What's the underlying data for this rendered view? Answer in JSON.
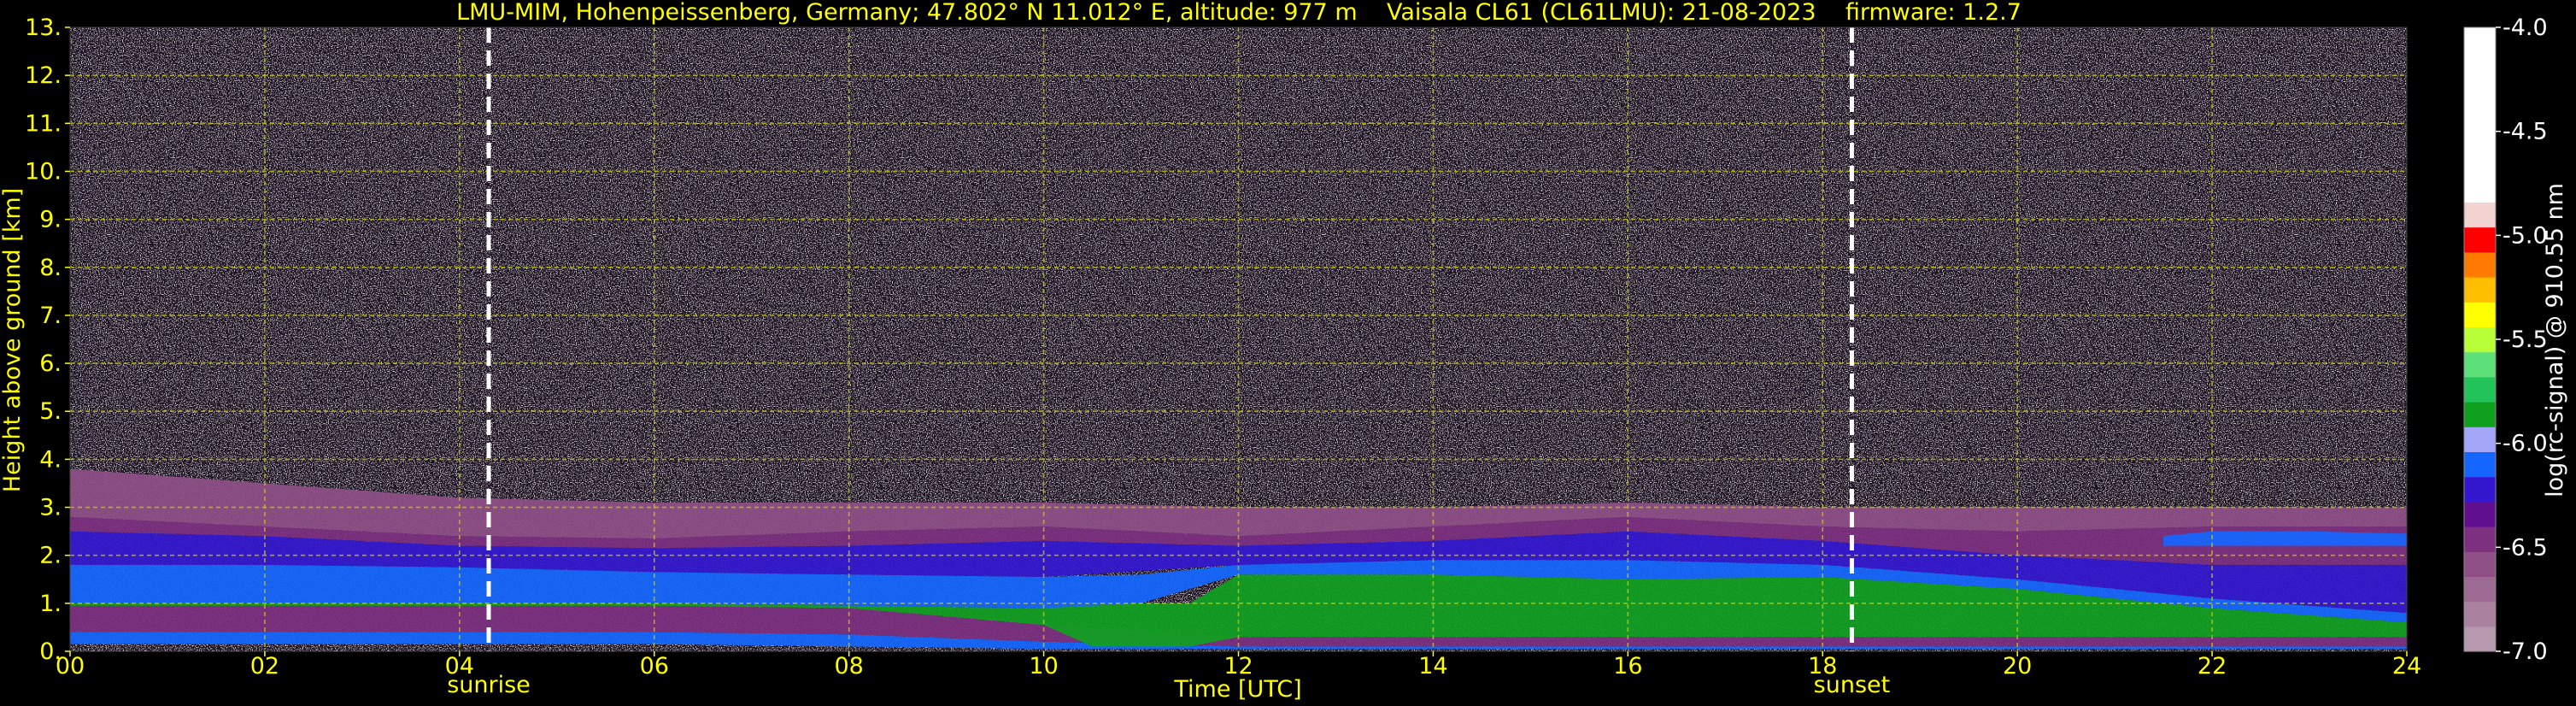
{
  "header": {
    "title": "LMU-MIM, Hohenpeissenberg, Germany; 47.802° N 11.012° E, altitude: 977 m    Vaisala CL61 (CL61LMU): 21-08-2023    firmware: 1.2.7"
  },
  "chart_data": {
    "type": "heatmap",
    "xlabel": "Time [UTC]",
    "ylabel": "Height above ground [km]",
    "xlim": [
      0,
      24
    ],
    "ylim": [
      0,
      13
    ],
    "x_ticks": [
      0,
      2,
      4,
      6,
      8,
      10,
      12,
      14,
      16,
      18,
      20,
      22,
      24
    ],
    "x_tick_labels": [
      "00",
      "02",
      "04",
      "06",
      "08",
      "10",
      "12",
      "14",
      "16",
      "18",
      "20",
      "22",
      "24"
    ],
    "y_ticks": [
      0,
      1,
      2,
      3,
      4,
      5,
      6,
      7,
      8,
      9,
      10,
      11,
      12,
      13
    ],
    "y_tick_labels": [
      "0.",
      "1.",
      "2.",
      "3.",
      "4.",
      "5.",
      "6.",
      "7.",
      "8.",
      "9.",
      "10.",
      "11.",
      "12.",
      "13."
    ],
    "grid": true,
    "markers": [
      {
        "label": "sunrise",
        "time": 4.3
      },
      {
        "label": "sunset",
        "time": 18.3
      }
    ],
    "colorbar": {
      "label": "log(rc-signal) @ 910.55 nm",
      "range": [
        -7.0,
        -4.0
      ],
      "ticks": [
        -4.0,
        -4.5,
        -5.0,
        -5.5,
        -6.0,
        -6.5,
        -7.0
      ],
      "tick_labels": [
        "-4.0",
        "-4.5",
        "-5.0",
        "-5.5",
        "-6.0",
        "-6.5",
        "-7.0"
      ],
      "steps": [
        {
          "from": -7.0,
          "to": -6.88,
          "color": "#b79aaf"
        },
        {
          "from": -6.88,
          "to": -6.76,
          "color": "#aa82a0"
        },
        {
          "from": -6.76,
          "to": -6.64,
          "color": "#9c6a93"
        },
        {
          "from": -6.64,
          "to": -6.52,
          "color": "#8e4f87"
        },
        {
          "from": -6.52,
          "to": -6.4,
          "color": "#7d2f80"
        },
        {
          "from": -6.4,
          "to": -6.28,
          "color": "#5f0f90"
        },
        {
          "from": -6.28,
          "to": -6.16,
          "color": "#3418d0"
        },
        {
          "from": -6.16,
          "to": -6.04,
          "color": "#1466ff"
        },
        {
          "from": -6.04,
          "to": -5.92,
          "color": "#a4a6f8"
        },
        {
          "from": -5.92,
          "to": -5.8,
          "color": "#10a020"
        },
        {
          "from": -5.8,
          "to": -5.68,
          "color": "#22c45a"
        },
        {
          "from": -5.68,
          "to": -5.56,
          "color": "#5ee07a"
        },
        {
          "from": -5.56,
          "to": -5.44,
          "color": "#b8ff38"
        },
        {
          "from": -5.44,
          "to": -5.32,
          "color": "#ffff00"
        },
        {
          "from": -5.32,
          "to": -5.2,
          "color": "#ffbe00"
        },
        {
          "from": -5.2,
          "to": -5.08,
          "color": "#ff7a00"
        },
        {
          "from": -5.08,
          "to": -4.96,
          "color": "#ff0000"
        },
        {
          "from": -4.96,
          "to": -4.84,
          "color": "#f3d2d2"
        },
        {
          "from": -4.84,
          "to": -4.0,
          "color": "#ffffff"
        }
      ]
    },
    "layers": [
      {
        "time": [
          0,
          2,
          4,
          6,
          8,
          10,
          12,
          14,
          16,
          18,
          20,
          22,
          24
        ],
        "bottom": [
          0.15,
          0.15,
          0.15,
          0.15,
          0.1,
          0.05,
          0.05,
          0.05,
          0.05,
          0.05,
          0.05,
          0.05,
          0.05
        ],
        "top": [
          0.4,
          0.4,
          0.4,
          0.4,
          0.35,
          0.2,
          0.1,
          0.1,
          0.1,
          0.1,
          0.1,
          0.1,
          0.1
        ],
        "value": -6.1
      },
      {
        "time": [
          0,
          2,
          4,
          6,
          8,
          10,
          12,
          14,
          16,
          18,
          20,
          22,
          24
        ],
        "bottom": [
          0.4,
          0.4,
          0.4,
          0.4,
          0.35,
          0.2,
          0.1,
          0.1,
          0.1,
          0.1,
          0.1,
          0.1,
          0.1
        ],
        "top": [
          0.95,
          0.95,
          0.95,
          0.95,
          0.9,
          0.55,
          0.3,
          0.3,
          0.3,
          0.3,
          0.3,
          0.3,
          0.3
        ],
        "value": -6.42
      },
      {
        "time": [
          0,
          2,
          4,
          6,
          8,
          10,
          10.5,
          11.5,
          12,
          14,
          16,
          18,
          20,
          22,
          24
        ],
        "bottom": [
          0.95,
          0.95,
          0.95,
          0.95,
          0.9,
          0.55,
          0.1,
          0.1,
          0.3,
          0.3,
          0.3,
          0.3,
          0.3,
          0.3,
          0.3
        ],
        "top": [
          1.0,
          1.0,
          1.0,
          1.0,
          0.95,
          0.9,
          1.0,
          1.0,
          1.6,
          1.6,
          1.5,
          1.55,
          1.3,
          0.9,
          0.6
        ],
        "value": -5.85
      },
      {
        "time": [
          0,
          2,
          4,
          6,
          8,
          10,
          11,
          12,
          14,
          16,
          18,
          20,
          22,
          24
        ],
        "bottom": [
          1.0,
          1.0,
          1.0,
          1.0,
          0.95,
          0.9,
          1.0,
          1.6,
          1.6,
          1.5,
          1.55,
          1.3,
          0.9,
          0.6
        ],
        "top": [
          1.8,
          1.8,
          1.75,
          1.65,
          1.6,
          1.55,
          1.6,
          1.8,
          1.9,
          1.9,
          1.8,
          1.5,
          1.1,
          0.8
        ],
        "value": -6.1
      },
      {
        "time": [
          0,
          2,
          4,
          6,
          8,
          10,
          12,
          14,
          16,
          18,
          20,
          22,
          24
        ],
        "bottom": [
          1.8,
          1.8,
          1.75,
          1.65,
          1.6,
          1.55,
          1.8,
          1.9,
          1.9,
          1.8,
          1.5,
          1.1,
          0.8
        ],
        "top": [
          2.5,
          2.4,
          2.2,
          2.15,
          2.2,
          2.3,
          2.2,
          2.3,
          2.5,
          2.3,
          2.0,
          1.8,
          1.8
        ],
        "value": -6.25
      },
      {
        "time": [
          0,
          2,
          4,
          6,
          8,
          10,
          12,
          14,
          16,
          18,
          20,
          22,
          24
        ],
        "bottom": [
          2.5,
          2.4,
          2.2,
          2.15,
          2.2,
          2.3,
          2.2,
          2.3,
          2.5,
          2.3,
          2.0,
          1.8,
          1.8
        ],
        "top": [
          2.8,
          2.6,
          2.4,
          2.35,
          2.5,
          2.6,
          2.4,
          2.6,
          2.8,
          2.6,
          2.5,
          2.6,
          2.6
        ],
        "value": -6.45
      },
      {
        "time": [
          21.5,
          22,
          23,
          24
        ],
        "bottom": [
          2.2,
          2.2,
          2.2,
          2.2
        ],
        "top": [
          2.4,
          2.5,
          2.5,
          2.45
        ],
        "value": -6.1
      },
      {
        "time": [
          0,
          2,
          4,
          6,
          8,
          10,
          12,
          14,
          16,
          18,
          20,
          22,
          24
        ],
        "bottom": [
          2.8,
          2.6,
          2.4,
          2.35,
          2.5,
          2.6,
          2.4,
          2.6,
          2.8,
          2.6,
          2.5,
          2.6,
          2.6
        ],
        "top": [
          3.8,
          3.5,
          3.2,
          3.1,
          3.1,
          3.1,
          3.0,
          3.0,
          3.1,
          3.0,
          3.0,
          3.0,
          3.0
        ],
        "value": -6.6
      }
    ]
  }
}
